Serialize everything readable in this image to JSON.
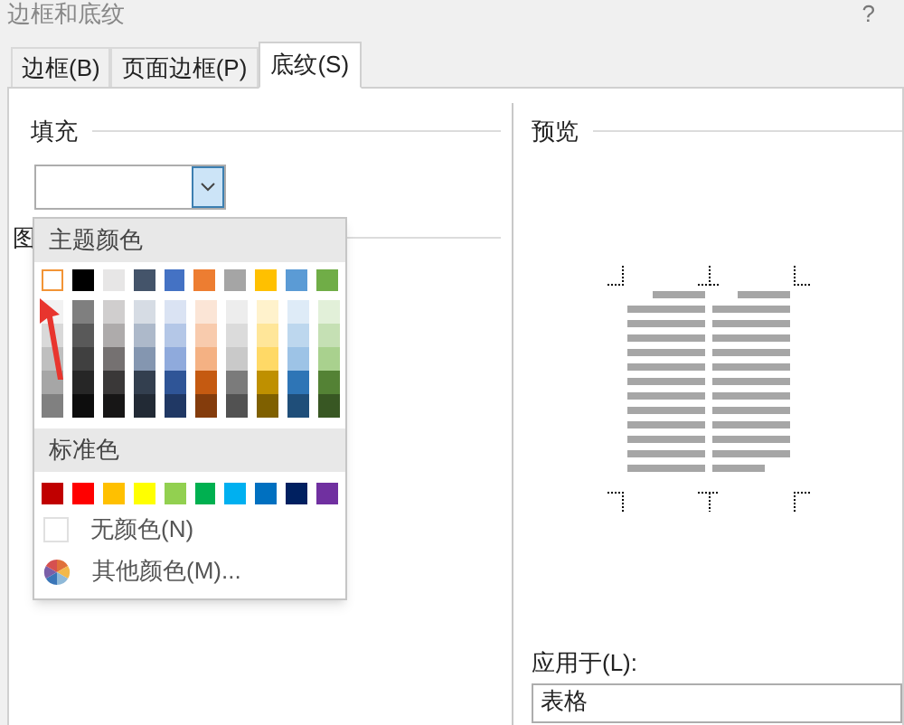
{
  "window": {
    "title": "边框和底纹",
    "help": "?"
  },
  "tabs": [
    {
      "label": "边框(B)",
      "selected": false
    },
    {
      "label": "页面边框(P)",
      "selected": false
    },
    {
      "label": "底纹(S)",
      "selected": true
    }
  ],
  "fill": {
    "label": "填充",
    "dropdown_open": true
  },
  "pattern": {
    "label": "图"
  },
  "color_menu": {
    "theme_heading": "主题颜色",
    "theme_colors": [
      {
        "color": "#ffffff",
        "selected": true,
        "shades": [
          {
            "color": "#f2f2f2"
          },
          {
            "color": "#d9d9d9"
          },
          {
            "color": "#bfbfbf"
          },
          {
            "color": "#a6a6a6"
          },
          {
            "color": "#808080"
          }
        ]
      },
      {
        "color": "#000000",
        "selected": false,
        "shades": [
          {
            "color": "#7f7f7f"
          },
          {
            "color": "#595959"
          },
          {
            "color": "#404040"
          },
          {
            "color": "#262626"
          },
          {
            "color": "#0d0d0d"
          }
        ]
      },
      {
        "color": "#e7e6e6",
        "selected": false,
        "shades": [
          {
            "color": "#d0cece"
          },
          {
            "color": "#aeabab"
          },
          {
            "color": "#757171"
          },
          {
            "color": "#3a3838"
          },
          {
            "color": "#171616"
          }
        ]
      },
      {
        "color": "#44546a",
        "selected": false,
        "shades": [
          {
            "color": "#d6dce4"
          },
          {
            "color": "#adb9ca"
          },
          {
            "color": "#8496b0"
          },
          {
            "color": "#333f4f"
          },
          {
            "color": "#222a35"
          }
        ]
      },
      {
        "color": "#4472c4",
        "selected": false,
        "shades": [
          {
            "color": "#dae3f3"
          },
          {
            "color": "#b4c7e7"
          },
          {
            "color": "#8faadc"
          },
          {
            "color": "#2f5597"
          },
          {
            "color": "#203864"
          }
        ]
      },
      {
        "color": "#ed7d31",
        "selected": false,
        "shades": [
          {
            "color": "#fbe5d6"
          },
          {
            "color": "#f8cbad"
          },
          {
            "color": "#f4b183"
          },
          {
            "color": "#c55a11"
          },
          {
            "color": "#843c0c"
          }
        ]
      },
      {
        "color": "#a5a5a5",
        "selected": false,
        "shades": [
          {
            "color": "#ededed"
          },
          {
            "color": "#dbdbdb"
          },
          {
            "color": "#c9c9c9"
          },
          {
            "color": "#7b7b7b"
          },
          {
            "color": "#525252"
          }
        ]
      },
      {
        "color": "#ffc000",
        "selected": false,
        "shades": [
          {
            "color": "#fff2cc"
          },
          {
            "color": "#ffe699"
          },
          {
            "color": "#ffd966"
          },
          {
            "color": "#bf9000"
          },
          {
            "color": "#7f6000"
          }
        ]
      },
      {
        "color": "#5b9bd5",
        "selected": false,
        "shades": [
          {
            "color": "#deebf7"
          },
          {
            "color": "#bdd7ee"
          },
          {
            "color": "#9dc3e6"
          },
          {
            "color": "#2e75b6"
          },
          {
            "color": "#1f4e79"
          }
        ]
      },
      {
        "color": "#70ad47",
        "selected": false,
        "shades": [
          {
            "color": "#e2f0d9"
          },
          {
            "color": "#c5e0b4"
          },
          {
            "color": "#a9d18e"
          },
          {
            "color": "#548235"
          },
          {
            "color": "#385723"
          }
        ]
      }
    ],
    "standard_heading": "标准色",
    "standard_colors": [
      {
        "color": "#c00000"
      },
      {
        "color": "#ff0000"
      },
      {
        "color": "#ffc000"
      },
      {
        "color": "#ffff00"
      },
      {
        "color": "#92d050"
      },
      {
        "color": "#00b050"
      },
      {
        "color": "#00b0f0"
      },
      {
        "color": "#0070c0"
      },
      {
        "color": "#002060"
      },
      {
        "color": "#7030a0"
      }
    ],
    "no_color": "无颜色(N)",
    "more_colors": "其他颜色(M)..."
  },
  "preview": {
    "label": "预览"
  },
  "apply_to": {
    "label": "应用于(L):",
    "value": "表格"
  }
}
